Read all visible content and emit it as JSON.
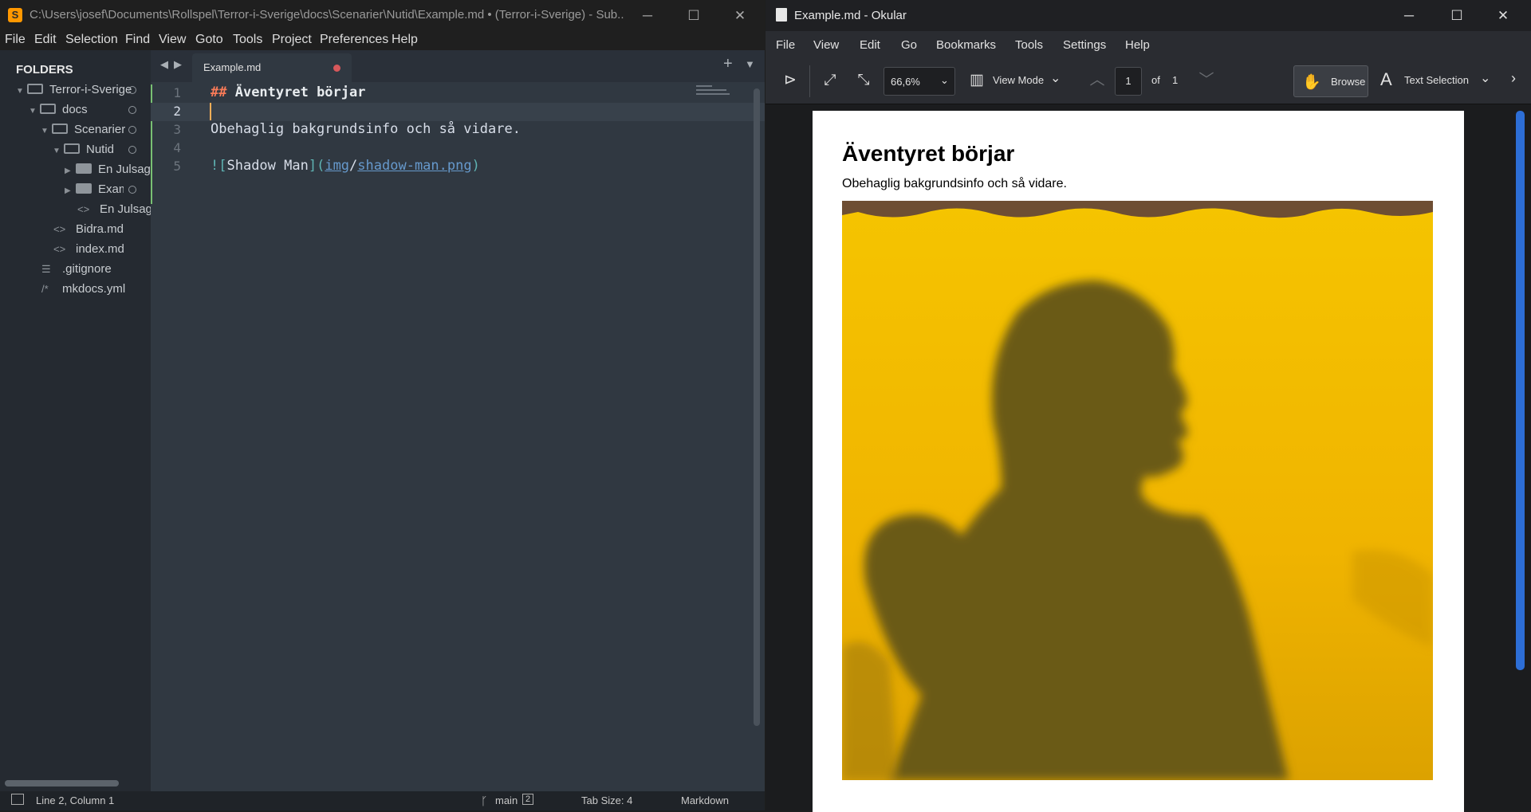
{
  "sublime": {
    "title": "C:\\Users\\josef\\Documents\\Rollspel\\Terror-i-Sverige\\docs\\Scenarier\\Nutid\\Example.md • (Terror-i-Sverige) - Sub...",
    "app_icon": "S",
    "menu": [
      "File",
      "Edit",
      "Selection",
      "Find",
      "View",
      "Goto",
      "Tools",
      "Project",
      "Preferences",
      "Help"
    ],
    "sidebar": {
      "header": "FOLDERS",
      "items": [
        {
          "label": "Terror-i-Sverige",
          "type": "folder-open"
        },
        {
          "label": "docs",
          "type": "folder-open"
        },
        {
          "label": "Scenarier",
          "type": "folder-open"
        },
        {
          "label": "Nutid",
          "type": "folder-open"
        },
        {
          "label": "En Julsaga",
          "type": "folder"
        },
        {
          "label": "Example",
          "type": "folder"
        },
        {
          "label": "En Julsaga",
          "type": "file"
        },
        {
          "label": "Bidra.md",
          "type": "file"
        },
        {
          "label": "index.md",
          "type": "file"
        },
        {
          "label": ".gitignore",
          "type": "file"
        },
        {
          "label": "mkdocs.yml",
          "type": "file"
        }
      ]
    },
    "tab": {
      "label": "Example.md"
    },
    "editor": {
      "line_numbers": [
        "1",
        "2",
        "3",
        "4",
        "5"
      ],
      "lines": [
        {
          "hash": "##",
          "text": " Äventyret börjar"
        },
        {
          "text": ""
        },
        {
          "text": "Obehaglig bakgrundsinfo och så vidare."
        },
        {
          "text": ""
        },
        {
          "prefix": "![",
          "alt": "Shadow Man",
          "mid": "](",
          "url_dir": "img",
          "slash": "/",
          "url_file": "shadow-man.png",
          "close": ")"
        }
      ]
    },
    "status": {
      "position": "Line 2, Column 1",
      "branch": "main",
      "branch_count": "2",
      "tab_size": "Tab Size: 4",
      "syntax": "Markdown"
    }
  },
  "okular": {
    "title": "Example.md  - Okular",
    "menu": [
      "File",
      "View",
      "Edit",
      "Go",
      "Bookmarks",
      "Tools",
      "Settings",
      "Help"
    ],
    "toolbar": {
      "zoom": "66,6%",
      "view_mode": "View Mode",
      "page": "1",
      "of_label": "of",
      "total_pages": "1",
      "browse": "Browse",
      "text_selection": "Text Selection"
    },
    "document": {
      "heading": "Äventyret börjar",
      "paragraph": "Obehaglig bakgrundsinfo och så vidare."
    }
  }
}
